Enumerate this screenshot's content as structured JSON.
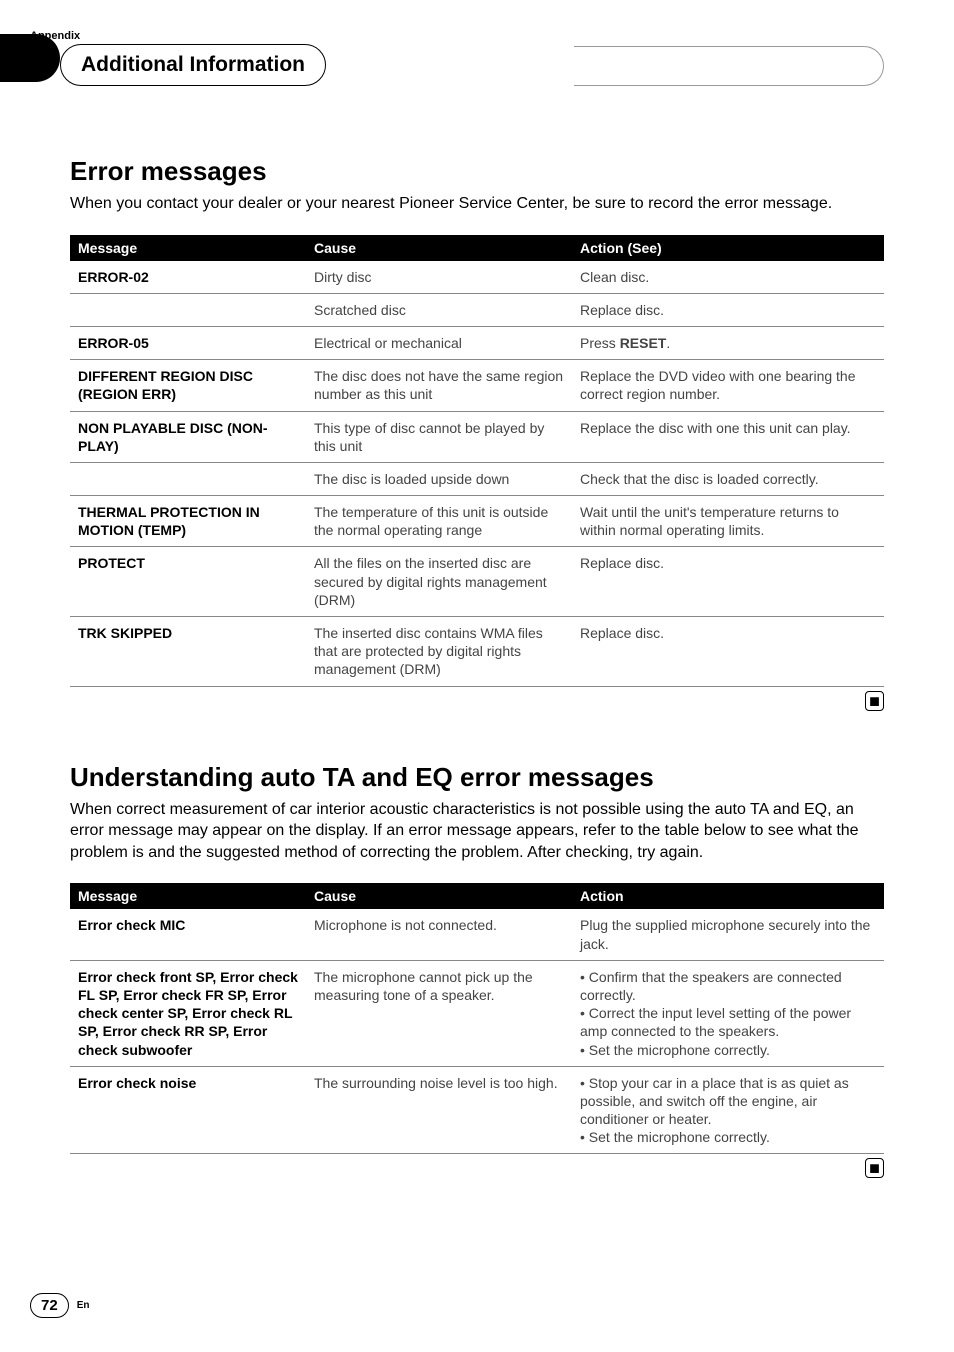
{
  "appendix_label": "Appendix",
  "header_title": "Additional Information",
  "section1": {
    "title": "Error messages",
    "intro": "When you contact your dealer or your nearest Pioneer Service Center, be sure to record the error message.",
    "headers": {
      "message": "Message",
      "cause": "Cause",
      "action": "Action (See)"
    },
    "rows": [
      {
        "message": "ERROR-02",
        "cause": "Dirty disc",
        "action": "Clean disc."
      },
      {
        "message": "",
        "cause": "Scratched disc",
        "action": "Replace disc."
      },
      {
        "message": "ERROR-05",
        "cause": "Electrical or mechanical",
        "action_pre": "Press ",
        "action_bold": "RESET",
        "action_post": "."
      },
      {
        "message": "DIFFERENT REGION DISC (REGION ERR)",
        "cause": "The disc does not have the same region number as this unit",
        "action": "Replace the DVD video with one bearing the correct region number."
      },
      {
        "message": "NON PLAYABLE DISC (NON-PLAY)",
        "cause": "This type of disc cannot be played by this unit",
        "action": "Replace the disc with one this unit can play."
      },
      {
        "message": "",
        "cause": "The disc is loaded upside down",
        "action": "Check that the disc is loaded correctly."
      },
      {
        "message": "THERMAL PROTECTION IN MOTION (TEMP)",
        "cause": "The temperature of this unit is outside the normal operating range",
        "action": "Wait until the unit's temperature returns to within normal operating limits."
      },
      {
        "message": "PROTECT",
        "cause": "All the files on the inserted disc are secured by digital rights management (DRM)",
        "action": "Replace disc."
      },
      {
        "message": "TRK SKIPPED",
        "cause": "The inserted disc contains WMA files that are protected by digital rights management (DRM)",
        "action": "Replace disc."
      }
    ]
  },
  "section2": {
    "title": "Understanding auto TA and EQ error messages",
    "intro": "When correct measurement of car interior acoustic characteristics is not possible using the auto TA and EQ, an error message may appear on the display. If an error message appears, refer to the table below to see what the problem is and the suggested method of correcting the problem. After checking, try again.",
    "headers": {
      "message": "Message",
      "cause": "Cause",
      "action": "Action"
    },
    "rows": [
      {
        "message": "Error check MIC",
        "cause": "Microphone is not connected.",
        "action": "Plug the supplied microphone securely into the jack."
      },
      {
        "message": "Error check front SP, Error check FL SP, Error check FR SP, Error check center SP, Error check RL SP, Error check RR SP, Error check subwoofer",
        "cause": "The microphone cannot pick up the measuring tone of a speaker.",
        "action": "• Confirm that the speakers are connected correctly.\n• Correct the input level setting of the power amp connected to the speakers.\n• Set the microphone correctly."
      },
      {
        "message": "Error check noise",
        "cause": "The surrounding noise level is too high.",
        "action": "• Stop your car in a place that is as quiet as possible, and switch off the engine, air conditioner or heater.\n• Set the microphone correctly."
      }
    ]
  },
  "end_mark": "■",
  "footer": {
    "page": "72",
    "lang": "En"
  }
}
